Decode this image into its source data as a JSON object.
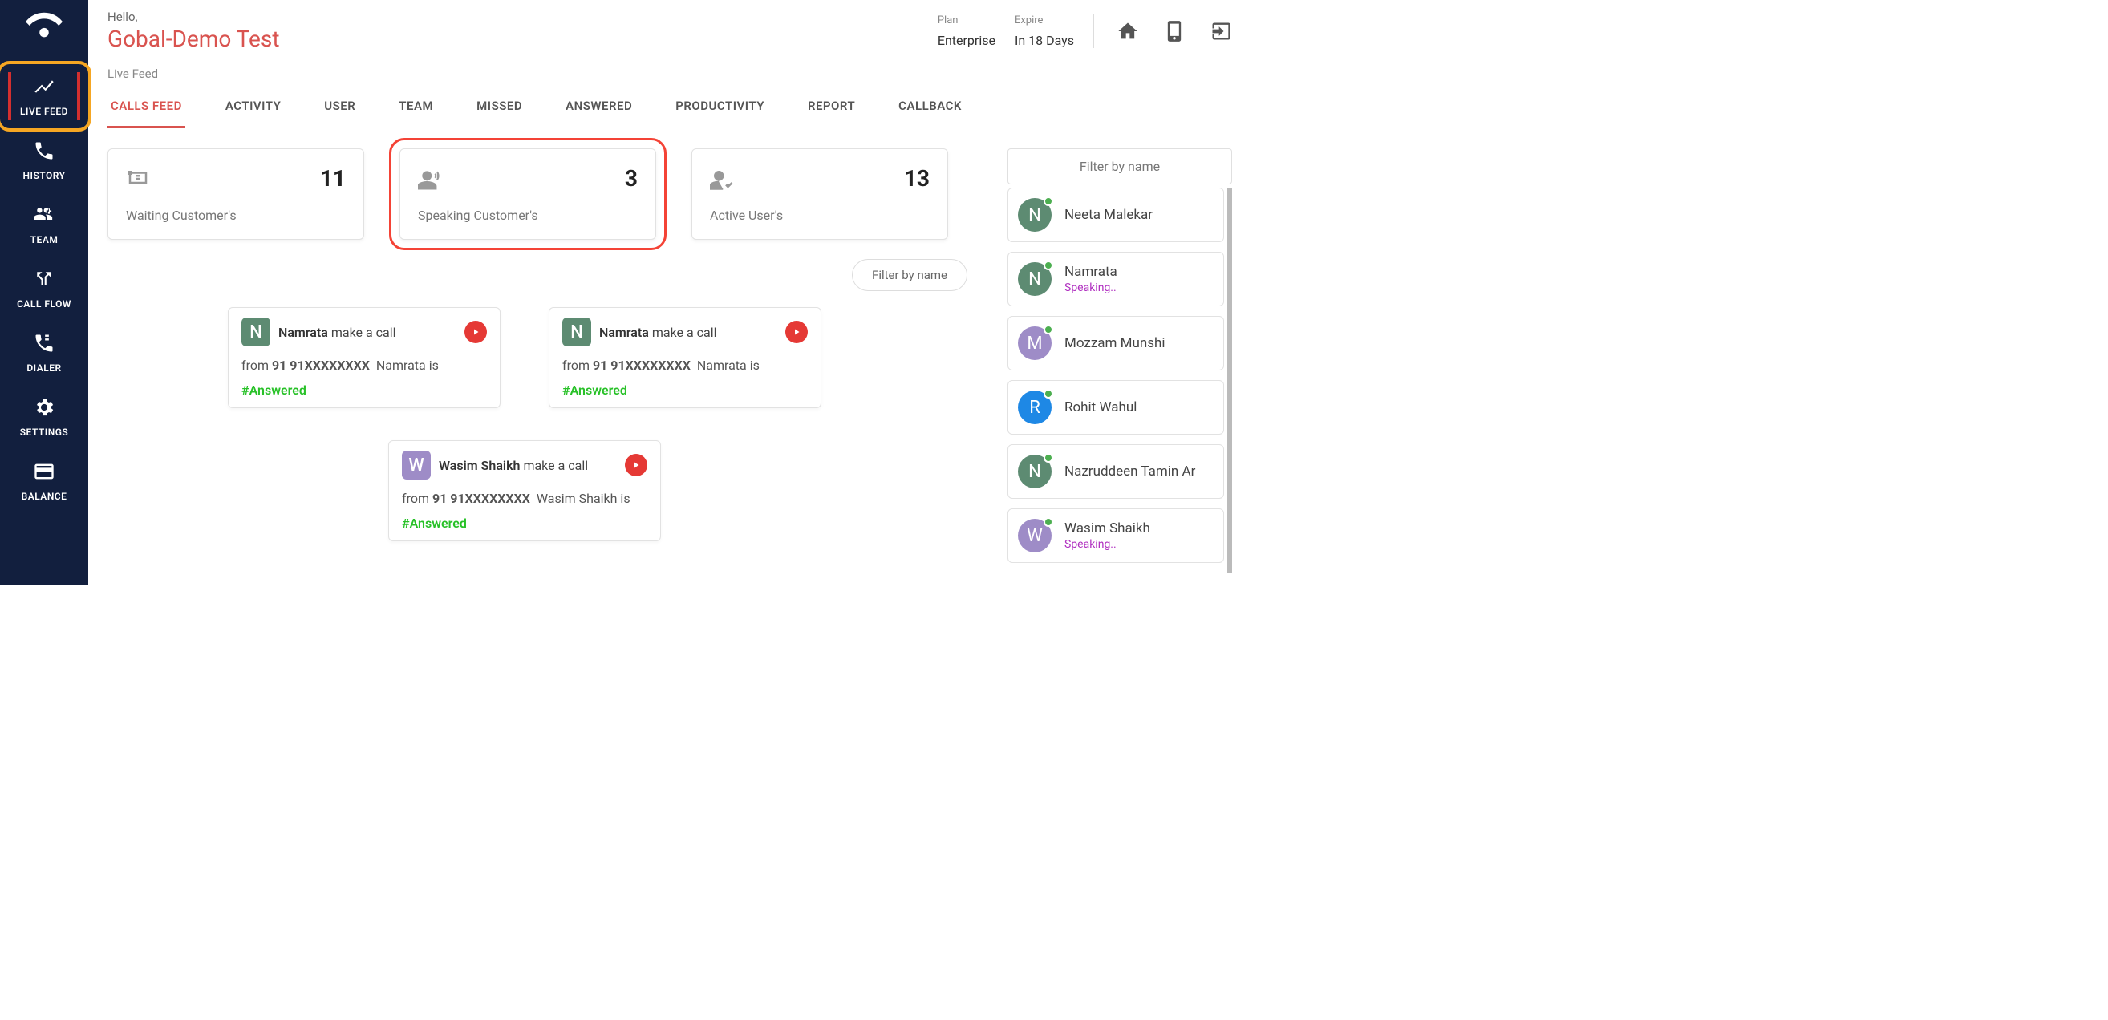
{
  "header": {
    "hello": "Hello,",
    "tenant": "Gobal-Demo Test",
    "plan_label": "Plan",
    "plan_value": "Enterprise",
    "expire_label": "Expire",
    "expire_value": "In 18 Days"
  },
  "sidebar": {
    "items": [
      {
        "label": "LIVE FEED"
      },
      {
        "label": "HISTORY"
      },
      {
        "label": "TEAM"
      },
      {
        "label": "CALL FLOW"
      },
      {
        "label": "DIALER"
      },
      {
        "label": "SETTINGS"
      },
      {
        "label": "BALANCE"
      }
    ]
  },
  "breadcrumb": "Live Feed",
  "tabs": [
    "CALLS FEED",
    "ACTIVITY",
    "USER",
    "TEAM",
    "MISSED",
    "ANSWERED",
    "PRODUCTIVITY",
    "REPORT",
    "CALLBACK"
  ],
  "stats": [
    {
      "value": "11",
      "label": "Waiting Customer's"
    },
    {
      "value": "3",
      "label": "Speaking Customer's"
    },
    {
      "value": "13",
      "label": "Active User's"
    }
  ],
  "filter_pill": "Filter by name",
  "feed": [
    {
      "initial": "N",
      "name": "Namrata",
      "action": "make a call",
      "from_label": "from",
      "number": "91 91XXXXXXXX",
      "who": "Namrata is",
      "status": "#Answered",
      "avatar_color": "bg-green"
    },
    {
      "initial": "N",
      "name": "Namrata",
      "action": "make a call",
      "from_label": "from",
      "number": "91 91XXXXXXXX",
      "who": "Namrata is",
      "status": "#Answered",
      "avatar_color": "bg-green"
    },
    {
      "initial": "W",
      "name": "Wasim Shaikh",
      "action": "make a call",
      "from_label": "from",
      "number": "91 91XXXXXXXX",
      "who": "Wasim Shaikh is",
      "status": "#Answered",
      "avatar_color": "bg-purple"
    }
  ],
  "right_filter": "Filter by name",
  "users": [
    {
      "initial": "N",
      "name": "Neeta Malekar",
      "status": "",
      "color": "bg-green"
    },
    {
      "initial": "N",
      "name": "Namrata",
      "status": "Speaking..",
      "color": "bg-green"
    },
    {
      "initial": "M",
      "name": "Mozzam Munshi",
      "status": "",
      "color": "bg-purple"
    },
    {
      "initial": "R",
      "name": "Rohit Wahul",
      "status": "",
      "color": "bg-blue"
    },
    {
      "initial": "N",
      "name": "Nazruddeen Tamin Ar",
      "status": "",
      "color": "bg-green"
    },
    {
      "initial": "W",
      "name": "Wasim Shaikh",
      "status": "Speaking..",
      "color": "bg-purple"
    }
  ]
}
